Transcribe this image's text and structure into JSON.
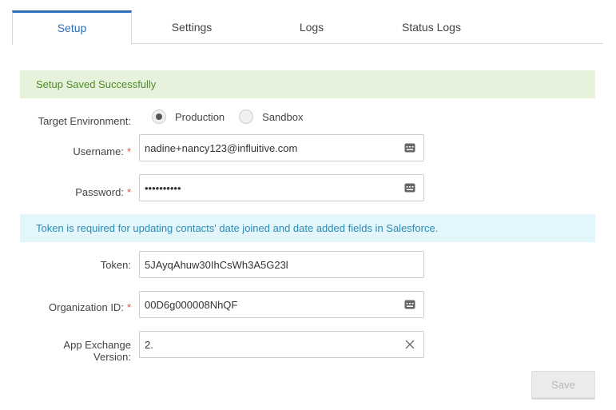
{
  "tabs": [
    {
      "label": "Setup",
      "active": true
    },
    {
      "label": "Settings",
      "active": false
    },
    {
      "label": "Logs",
      "active": false
    },
    {
      "label": "Status Logs",
      "active": false
    }
  ],
  "alerts": {
    "success": "Setup Saved Successfully",
    "token_info": "Token is required for updating contacts' date joined and date added fields in Salesforce."
  },
  "form": {
    "target_environment": {
      "label": "Target Environment:",
      "options": [
        "Production",
        "Sandbox"
      ],
      "selected": "Production"
    },
    "username": {
      "label": "Username:",
      "required": true,
      "value": "nadine+nancy123@influitive.com"
    },
    "password": {
      "label": "Password:",
      "required": true,
      "value": "••••••••••"
    },
    "token": {
      "label": "Token:",
      "required": false,
      "value": "5JAyqAhuw30IhCsWh3A5G23l"
    },
    "organization_id": {
      "label": "Organization ID:",
      "required": true,
      "value": "00D6g000008NhQF"
    },
    "app_exchange_version": {
      "label_line1": "App Exchange",
      "label_line2": "Version:",
      "required": false,
      "value": "2."
    },
    "required_marker": "*"
  },
  "buttons": {
    "save": "Save"
  },
  "colors": {
    "accent": "#2d6fb6",
    "success_bg": "#e7f2dc",
    "info_bg": "#e3f6fb",
    "required": "#d9534f"
  }
}
